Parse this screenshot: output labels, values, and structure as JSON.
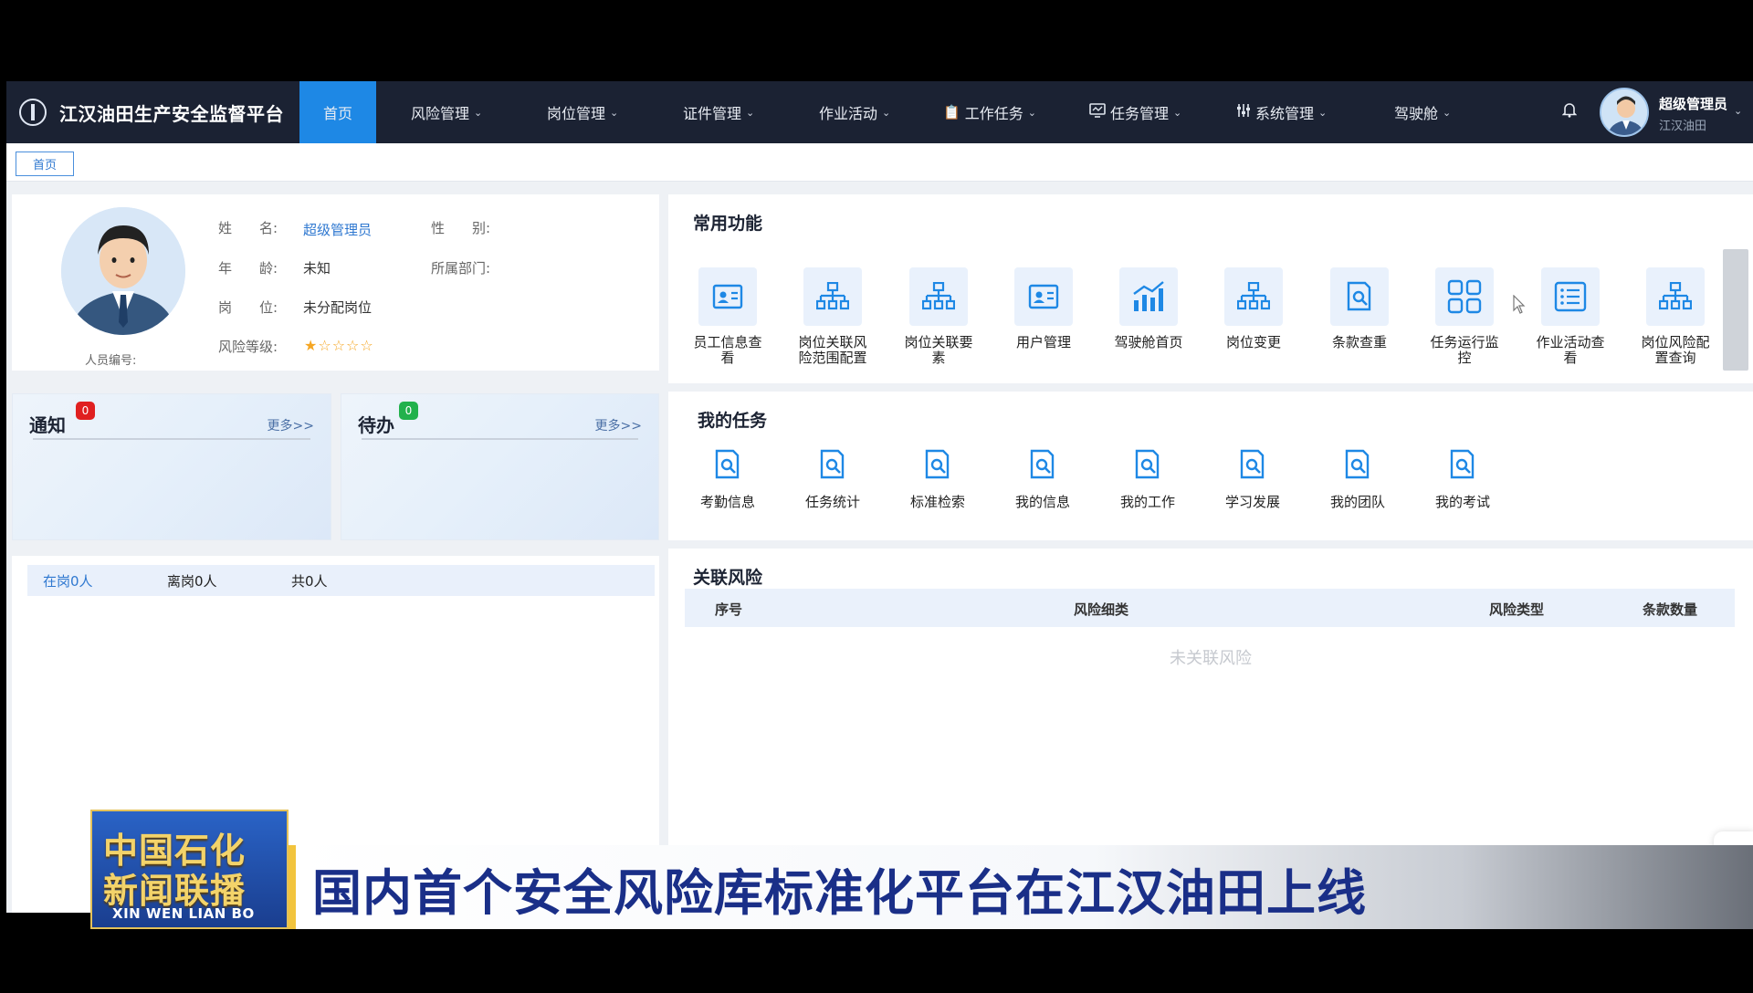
{
  "app": {
    "title": "江汉油田生产安全监督平台"
  },
  "nav": {
    "items": [
      {
        "label": "首页",
        "caret": ""
      },
      {
        "label": "风险管理",
        "caret": "⌄"
      },
      {
        "label": "岗位管理",
        "caret": "⌄"
      },
      {
        "label": "证件管理",
        "caret": "⌄"
      },
      {
        "label": "作业活动",
        "caret": "⌄"
      },
      {
        "label": "工作任务",
        "caret": "⌄"
      },
      {
        "label": "任务管理",
        "caret": "⌄"
      },
      {
        "label": "系统管理",
        "caret": "⌄"
      },
      {
        "label": "驾驶舱",
        "caret": "⌄"
      }
    ],
    "bell_icon": "bell-icon",
    "user": {
      "role": "超级管理员",
      "org": "江汉油田"
    }
  },
  "breadcrumb": {
    "home": "首页"
  },
  "profile": {
    "name_label": "姓　　名:",
    "name_value": "超级管理员",
    "gender_label": "性　　别:",
    "gender_value": "",
    "age_label": "年　　龄:",
    "age_value": "未知",
    "dept_label": "所属部门:",
    "dept_value": "",
    "post_label": "岗　　位:",
    "post_value": "未分配岗位",
    "risk_label": "风险等级:",
    "risk_stars_filled": 1,
    "risk_stars_total": 5,
    "employee_no_label": "人员编号:"
  },
  "notice": {
    "title": "通知",
    "badge": "0",
    "more": "更多>>"
  },
  "todo": {
    "title": "待办",
    "badge": "0",
    "more": "更多>>"
  },
  "staff": {
    "on_duty": "在岗0人",
    "off_duty": "离岗0人",
    "total": "共0人"
  },
  "common": {
    "title": "常用功能",
    "items": [
      {
        "label": "员工信息查看",
        "icon": "id-card-icon"
      },
      {
        "label": "岗位关联风险范围配置",
        "icon": "org-chart-icon"
      },
      {
        "label": "岗位关联要素",
        "icon": "org-chart-icon"
      },
      {
        "label": "用户管理",
        "icon": "id-card-icon"
      },
      {
        "label": "驾驶舱首页",
        "icon": "bar-chart-icon"
      },
      {
        "label": "岗位变更",
        "icon": "org-chart-icon"
      },
      {
        "label": "条款查重",
        "icon": "doc-search-icon"
      },
      {
        "label": "任务运行监控",
        "icon": "grid-icon"
      },
      {
        "label": "作业活动查看",
        "icon": "list-icon"
      },
      {
        "label": "岗位风险配置查询",
        "icon": "org-chart-icon"
      }
    ]
  },
  "tasks": {
    "title": "我的任务",
    "items": [
      {
        "label": "考勤信息"
      },
      {
        "label": "任务统计"
      },
      {
        "label": "标准检索"
      },
      {
        "label": "我的信息"
      },
      {
        "label": "我的工作"
      },
      {
        "label": "学习发展"
      },
      {
        "label": "我的团队"
      },
      {
        "label": "我的考试"
      }
    ]
  },
  "risk": {
    "title": "关联风险",
    "columns": [
      "序号",
      "风险细类",
      "风险类型",
      "条款数量"
    ],
    "empty": "未关联风险"
  },
  "news": {
    "logo_line1": "中国石化",
    "logo_line2": "新闻联播",
    "logo_en": "XIN WEN LIAN BO",
    "headline": "国内首个安全风险库标准化平台在江汉油田上线"
  },
  "colors": {
    "accent": "#1e88e5",
    "nav_bg": "#1b2233",
    "notice_badge": "#e02020",
    "todo_badge": "#22b14c",
    "headline": "#1a2f88"
  }
}
